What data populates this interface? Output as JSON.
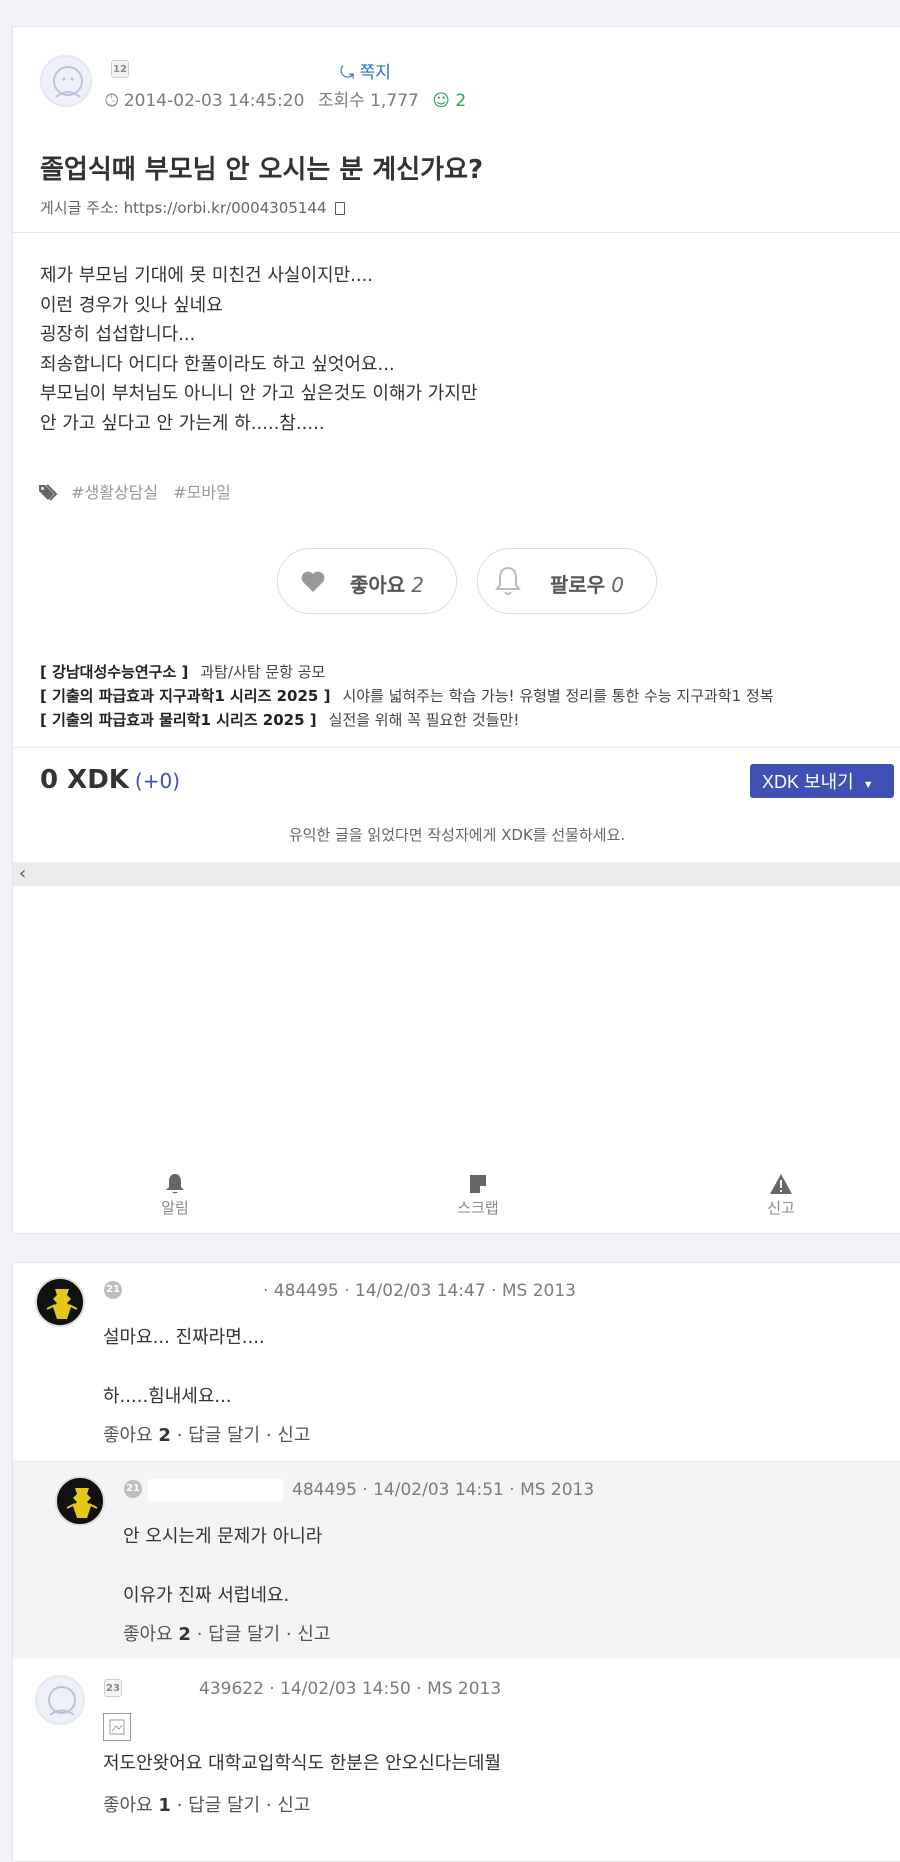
{
  "post": {
    "author_level": "12",
    "message_link": "쪽지",
    "datetime": "2014-02-03 14:45:20",
    "views_label": "조회수",
    "views": "1,777",
    "emoji_count": "2",
    "title": "졸업식때 부모님 안 오시는 분 계신가요?",
    "address_label": "게시글 주소:",
    "address_url": "https://orbi.kr/0004305144",
    "body": [
      "제가 부모님 기대에 못 미친건 사실이지만....",
      "이런 경우가 잇나 싶네요",
      "굉장히 섭섭합니다...",
      "죄송합니다 어디다 한풀이라도 하고 싶엇어요...",
      "부모님이 부처님도 아니니 안 가고 싶은것도 이해가 가지만",
      "안 가고 싶다고 안 가는게 하.....참....."
    ],
    "tags": [
      "#생활상담실",
      "#모바일"
    ],
    "like_label": "좋아요",
    "like_count": "2",
    "follow_label": "팔로우",
    "follow_count": "0"
  },
  "promos": [
    {
      "title": "[ 강남대성수능연구소 ]",
      "text": "과탐/사탐 문항 공모"
    },
    {
      "title": "[ 기출의 파급효과 지구과학1 시리즈 2025 ]",
      "text": "시야를 넓혀주는 학습 가능! 유형별 정리를 통한 수능 지구과학1 정복"
    },
    {
      "title": "[ 기출의 파급효과 물리학1 시리즈 2025 ]",
      "text": "실전을 위해 꼭 필요한 것들만!"
    }
  ],
  "xdk": {
    "amount": "0 XDK",
    "delta": "(+0)",
    "send_button": "XDK 보내기",
    "hint": "유익한 글을 읽었다면 작성자에게 XDK를 선물하세요."
  },
  "actions": {
    "alarm": "알림",
    "scrap": "스크랩",
    "report": "신고"
  },
  "comments": [
    {
      "level": "21",
      "meta": "· 484495 · 14/02/03 14:47 · MS 2013",
      "lines": [
        "설마요... 진짜라면....",
        "하.....힘내세요..."
      ],
      "like_label": "좋아요",
      "like_count": "2",
      "actions": "· 답글 달기 · 신고"
    },
    {
      "level": "21",
      "meta": "484495 · 14/02/03 14:51 · MS 2013",
      "lines": [
        "안 오시는게 문제가 아니라",
        "이유가 진짜 서럽네요."
      ],
      "like_label": "좋아요",
      "like_count": "2",
      "actions": "· 답글 달기 · 신고"
    },
    {
      "level": "23",
      "meta": "439622 · 14/02/03 14:50 · MS 2013",
      "lines": [
        "저도안왓어요 대학교입학식도 한분은 안오신다는데뭘"
      ],
      "like_label": "좋아요",
      "like_count": "1",
      "actions": "· 답글 달기 · 신고"
    }
  ]
}
